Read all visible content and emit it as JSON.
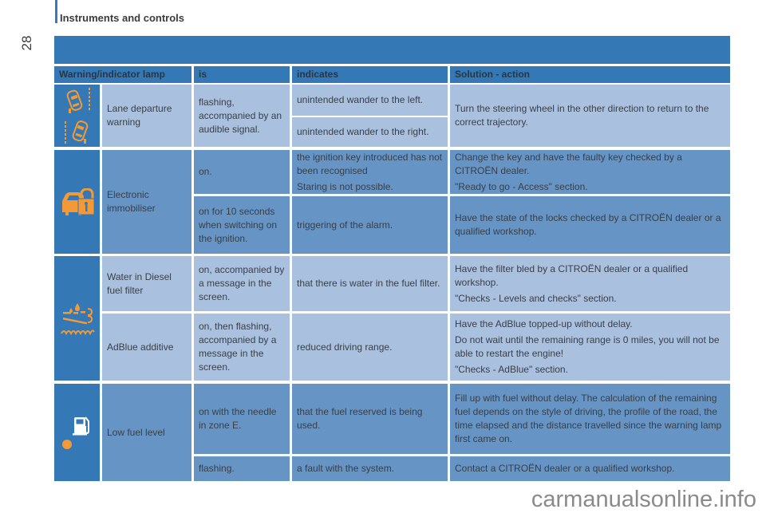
{
  "page": {
    "number": "28",
    "section_title": "Instruments and controls",
    "watermark": "carmanualsonline.info"
  },
  "table": {
    "headers": [
      "Warning/indicator lamp",
      "is",
      "indicates",
      "Solution - action"
    ],
    "rows": [
      {
        "icon": "lane-departure-icon",
        "label": "Lane departure warning",
        "sub": [
          {
            "is": "flashing, accompanied by an audible signal.",
            "indicates": "unintended wander to the left."
          },
          {
            "indicates": "unintended wander to the right."
          }
        ],
        "solution": [
          "Turn the steering wheel in the other direction to return to the correct trajectory."
        ]
      },
      {
        "icon": "immobiliser-icon",
        "label": "Electronic immobiliser",
        "sub": [
          {
            "is": "on.",
            "indicates": [
              "the ignition key introduced has not been recognised",
              "Staring is not possible."
            ],
            "solution": [
              "Change the key and have the faulty key checked by a CITROËN dealer.",
              "\"Ready to go - Access\" section."
            ]
          },
          {
            "is": "on for 10 seconds when switching on the ignition.",
            "indicates": [
              "triggering of the alarm."
            ],
            "solution": [
              "Have the state of the locks checked by a CITROËN dealer or a qualified workshop."
            ]
          }
        ]
      },
      {
        "icon": "water-in-diesel-icon",
        "sub": [
          {
            "label": "Water in Diesel fuel filter",
            "is": "on, accompanied by a message in the screen.",
            "indicates": [
              "that there is water in the fuel filter."
            ],
            "solution": [
              "Have the filter bled by a CITROËN dealer or a qualified workshop.",
              "\"Checks - Levels and checks\" section."
            ]
          },
          {
            "label": "AdBlue additive",
            "is": "on, then flashing, accompanied by a message in the screen.",
            "indicates": [
              "reduced driving range."
            ],
            "solution": [
              "Have the AdBlue topped-up without delay.",
              "Do not wait until the remaining range is 0 miles, you will not be able to restart the engine!",
              "\"Checks - AdBlue\" section."
            ]
          }
        ]
      },
      {
        "icon": "low-fuel-icon",
        "label": "Low fuel level",
        "sub": [
          {
            "is": "on with the needle in zone E.",
            "indicates": [
              "that the fuel reserved is being used."
            ],
            "solution": [
              "Fill up with fuel without delay. The calculation of the remaining fuel depends on the style of driving, the profile of the road, the time elapsed and the distance travelled since the warning lamp first came on."
            ]
          },
          {
            "is": "flashing.",
            "indicates": [
              "a fault with the system."
            ],
            "solution": [
              "Contact a CITROËN dealer or a qualified workshop."
            ]
          }
        ]
      }
    ]
  },
  "colors": {
    "header_blue": "#3479b5",
    "row_light": "#a9c0df",
    "row_mid": "#6694c4",
    "icon_orange": "#f39a36"
  }
}
